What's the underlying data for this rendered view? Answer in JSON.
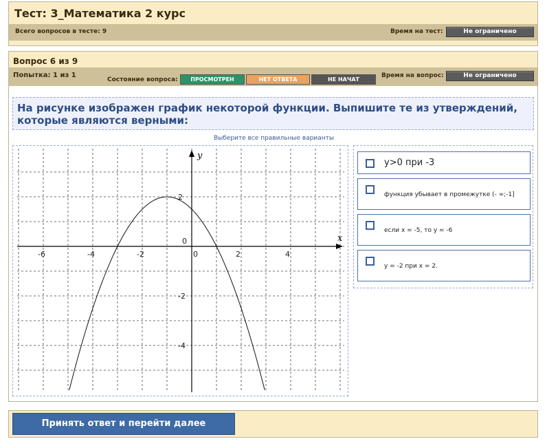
{
  "test": {
    "title": "Тест: 3_Математика 2 курс",
    "total_label": "Всего вопросов в тесте: 9",
    "time_label": "Время на тест:",
    "time_value": "Не ограничено",
    "progress_colors": [
      "#3f9a6e",
      "#3f9a6e",
      "#3f9a6e",
      "#3f9a6e",
      "#3f9a6e",
      "#c2465a",
      "#6f6f6f",
      "#6f6f6f",
      "#6f6f6f"
    ]
  },
  "question": {
    "number_label": "Вопрос 6 из 9",
    "attempt_label": "Попытка: 1 из 1",
    "state_label": "Состояние вопроса:",
    "states": [
      {
        "label": "ПРОСМОТРЕН",
        "color": "#2e9268"
      },
      {
        "label": "НЕТ ОТВЕТА",
        "color": "#e9a35f"
      },
      {
        "label": "НЕ НАЧАТ",
        "color": "#555555"
      }
    ],
    "time_label": "Время на вопрос:",
    "time_value": "Не ограничено",
    "text": "На рисунке изображен график некоторой функции. Выпишите те из утверждений, которые являются верными:",
    "hint": "Выберите все правильные варианты"
  },
  "graph": {
    "x_axis_label": "x",
    "y_axis_label": "y",
    "x_ticks": [
      "-6",
      "-4",
      "-2",
      "0",
      "2",
      "4"
    ],
    "y_ticks": [
      "2",
      "0",
      "-2",
      "-4"
    ]
  },
  "options": [
    {
      "text": "y>0 при -3"
    },
    {
      "text": "функция убывает в промежутке (- ∞;-1]"
    },
    {
      "text": "если x = -5, то y = -6"
    },
    {
      "text": "y = -2 при x = 2."
    }
  ],
  "footer": {
    "submit_label": "Принять ответ и перейти далее"
  }
}
